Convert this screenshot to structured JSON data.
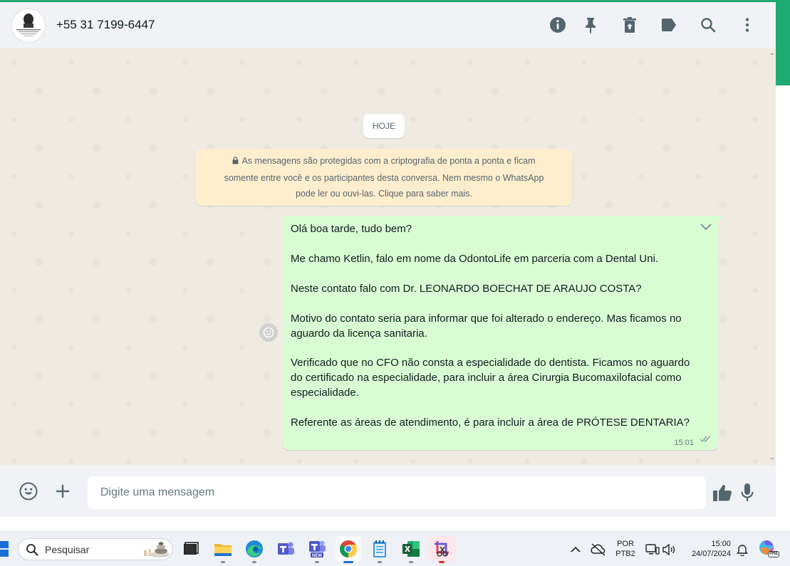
{
  "colors": {
    "accent": "#1faa73",
    "bubble_out": "#d9fdd3",
    "chat_bg": "#efeae2",
    "encryption_bg": "#ffeecd"
  },
  "header": {
    "contact_name": "+55 31 7199-6447",
    "icons": [
      "info-icon",
      "pin-icon",
      "delete-chat-icon",
      "label-icon",
      "search-icon",
      "menu-dots-icon"
    ]
  },
  "chat": {
    "day_label": "HOJE",
    "encryption_notice": {
      "lines": [
        "As mensagens são protegidas com a criptografia de ponta a ponta e ficam",
        "somente entre você e os participantes desta conversa. Nem mesmo o WhatsApp",
        "pode ler ou ouvi-las. Clique para saber mais."
      ]
    },
    "message": {
      "lines": [
        "Olá boa tarde, tudo bem?",
        "Me chamo Ketlin, falo em nome da OdontoLife em parceria com a Dental Uni.",
        "Neste contato falo com Dr. LEONARDO BOECHAT DE ARAUJO COSTA?",
        "Motivo do contato seria para informar que foi alterado o endereço. Mas ficamos no",
        "aguardo da licença sanitaria.",
        "Verificado que no CFO não consta a especialidade do dentista. Ficamos no aguardo",
        "do certificado na especialidade, para incluir a área Cirurgia Bucomaxilofacial como",
        "especialidade.",
        "Referente as áreas de atendimento, é para incluir a área de PRÓTESE DENTARIA?"
      ],
      "time": "15:01",
      "status": "delivered"
    }
  },
  "composer": {
    "placeholder": "Digite uma mensagem"
  },
  "taskbar": {
    "search_label": "Pesquisar",
    "apps": [
      "desktop",
      "file-explorer",
      "edge",
      "teams",
      "teams-new",
      "chrome",
      "notepad",
      "excel",
      "snipping-tool"
    ],
    "tray": {
      "lang_line1": "POR",
      "lang_line2": "PTB2",
      "time": "15:00",
      "date": "24/07/2024",
      "copilot_badge": "PRE"
    }
  }
}
